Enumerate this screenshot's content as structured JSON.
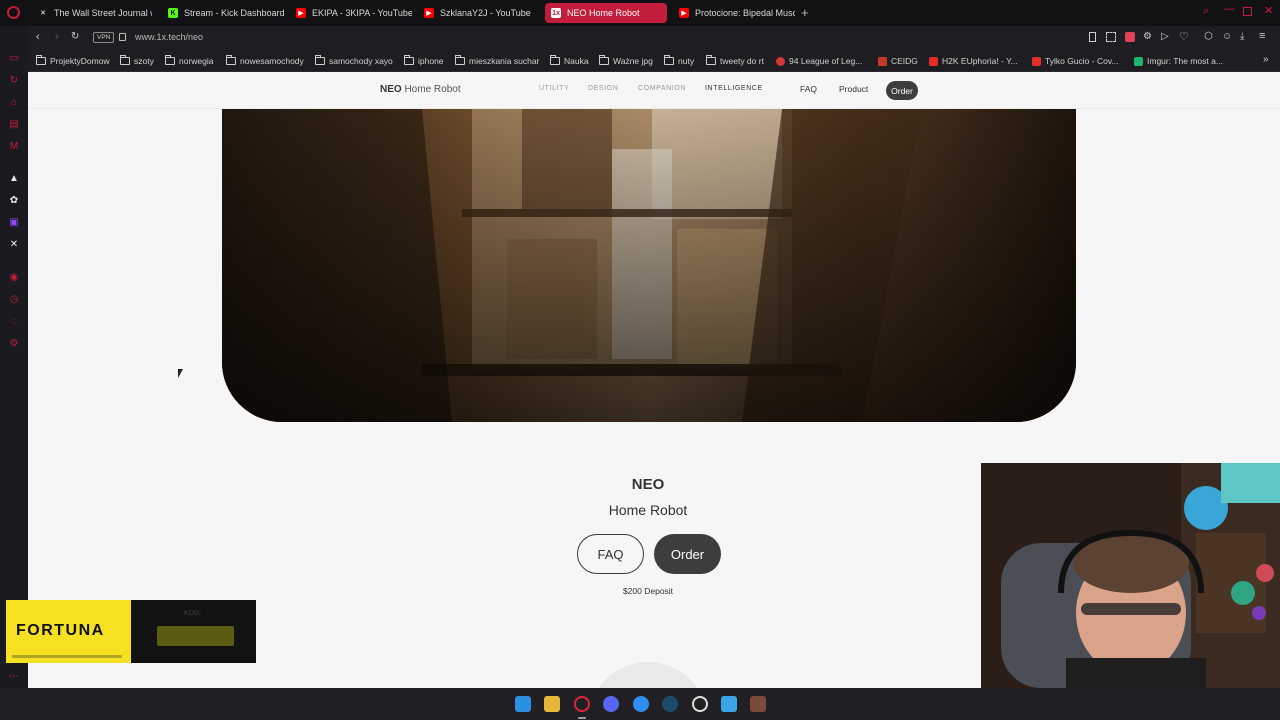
{
  "tabs": [
    {
      "label": "The Wall Street Journal w",
      "icon": "x-icon",
      "color": "#ffffff"
    },
    {
      "label": "Stream - Kick Dashboard",
      "icon": "kick-icon",
      "color": "#53fc18"
    },
    {
      "label": "EKIPA - 3KIPA - YouTube",
      "icon": "youtube-icon",
      "color": "#ff0000"
    },
    {
      "label": "SzklanaY2J - YouTube",
      "icon": "youtube-icon",
      "color": "#ff0000"
    },
    {
      "label": "NEO Home Robot",
      "icon": "1x-icon",
      "color": "#ffffff",
      "active": true
    },
    {
      "label": "Protocione: Bipedal Musc",
      "icon": "youtube-icon",
      "color": "#ff0000"
    }
  ],
  "address": {
    "vpn_label": "VPN",
    "url": "www.1x.tech/neo"
  },
  "bookmarks": [
    {
      "label": "ProjektyDomow",
      "type": "folder"
    },
    {
      "label": "szoty",
      "type": "folder"
    },
    {
      "label": "norwegia",
      "type": "folder"
    },
    {
      "label": "nowesamochody",
      "type": "folder"
    },
    {
      "label": "samochody xayo",
      "type": "folder"
    },
    {
      "label": "iphone",
      "type": "folder"
    },
    {
      "label": "mieszkania suchar",
      "type": "folder"
    },
    {
      "label": "Nauka",
      "type": "folder"
    },
    {
      "label": "Ważne jpg",
      "type": "folder"
    },
    {
      "label": "nuty",
      "type": "folder"
    },
    {
      "label": "tweety do rt",
      "type": "folder"
    },
    {
      "label": "94 League of Leg...",
      "type": "site",
      "color": "#d13639"
    },
    {
      "label": "CEIDG",
      "type": "site",
      "color": "#c0392b"
    },
    {
      "label": "H2K EUphoria! - Y...",
      "type": "site",
      "color": "#e52d27"
    },
    {
      "label": "Tylko Gucio - Cov...",
      "type": "site",
      "color": "#e52d27"
    },
    {
      "label": "Imgur: The most a...",
      "type": "site",
      "color": "#1bb76e"
    }
  ],
  "site": {
    "brand_strong": "NEO",
    "brand_light": "Home Robot",
    "nav": [
      "UTILITY",
      "DESIGN",
      "COMPANION",
      "INTELLIGENCE"
    ],
    "faq_label": "FAQ",
    "product_label": "Product",
    "order_label": "Order"
  },
  "hero": {
    "title": "NEO",
    "subtitle": "Home Robot",
    "faq_button": "FAQ",
    "order_button": "Order",
    "deposit": "$200 Deposit"
  },
  "overlay": {
    "fortuna_brand": "FORTUNA",
    "kod_label": "KOD:"
  },
  "colors": {
    "accent": "#c21d3a",
    "page_bg": "#f6f6f6",
    "button_dark": "#3d3d3d",
    "fortuna_yellow": "#f5e021"
  }
}
